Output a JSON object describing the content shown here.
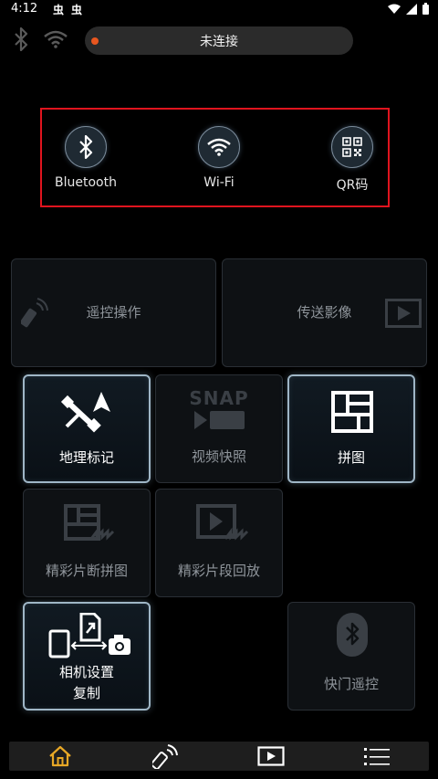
{
  "status_bar": {
    "time": "4:12",
    "notif_1": "虫",
    "notif_2": "虫"
  },
  "connection": {
    "status_text": "未连接",
    "status_dot_color": "#e8561f"
  },
  "connect_options": [
    {
      "label": "Bluetooth"
    },
    {
      "label": "Wi-Fi"
    },
    {
      "label": "QR码"
    }
  ],
  "tiles": {
    "remote": "遥控操作",
    "transfer": "传送影像",
    "geotag": "地理标记",
    "snap_movie": "视频快照",
    "snap_text": "SNAP",
    "collage": "拼图",
    "highlight_collage": "精彩片断拼图",
    "highlight_playback": "精彩片段回放",
    "camera_copy_1": "相机设置",
    "camera_copy_2": "复制",
    "shutter_remote": "快门遥控"
  },
  "colors": {
    "accent_home": "#e8a826",
    "highlight_border": "#e0141e"
  },
  "bottom_nav": [
    {
      "icon": "home-icon",
      "active": true
    },
    {
      "icon": "remote-icon",
      "active": false
    },
    {
      "icon": "play-icon",
      "active": false
    },
    {
      "icon": "menu-icon",
      "active": false
    }
  ]
}
